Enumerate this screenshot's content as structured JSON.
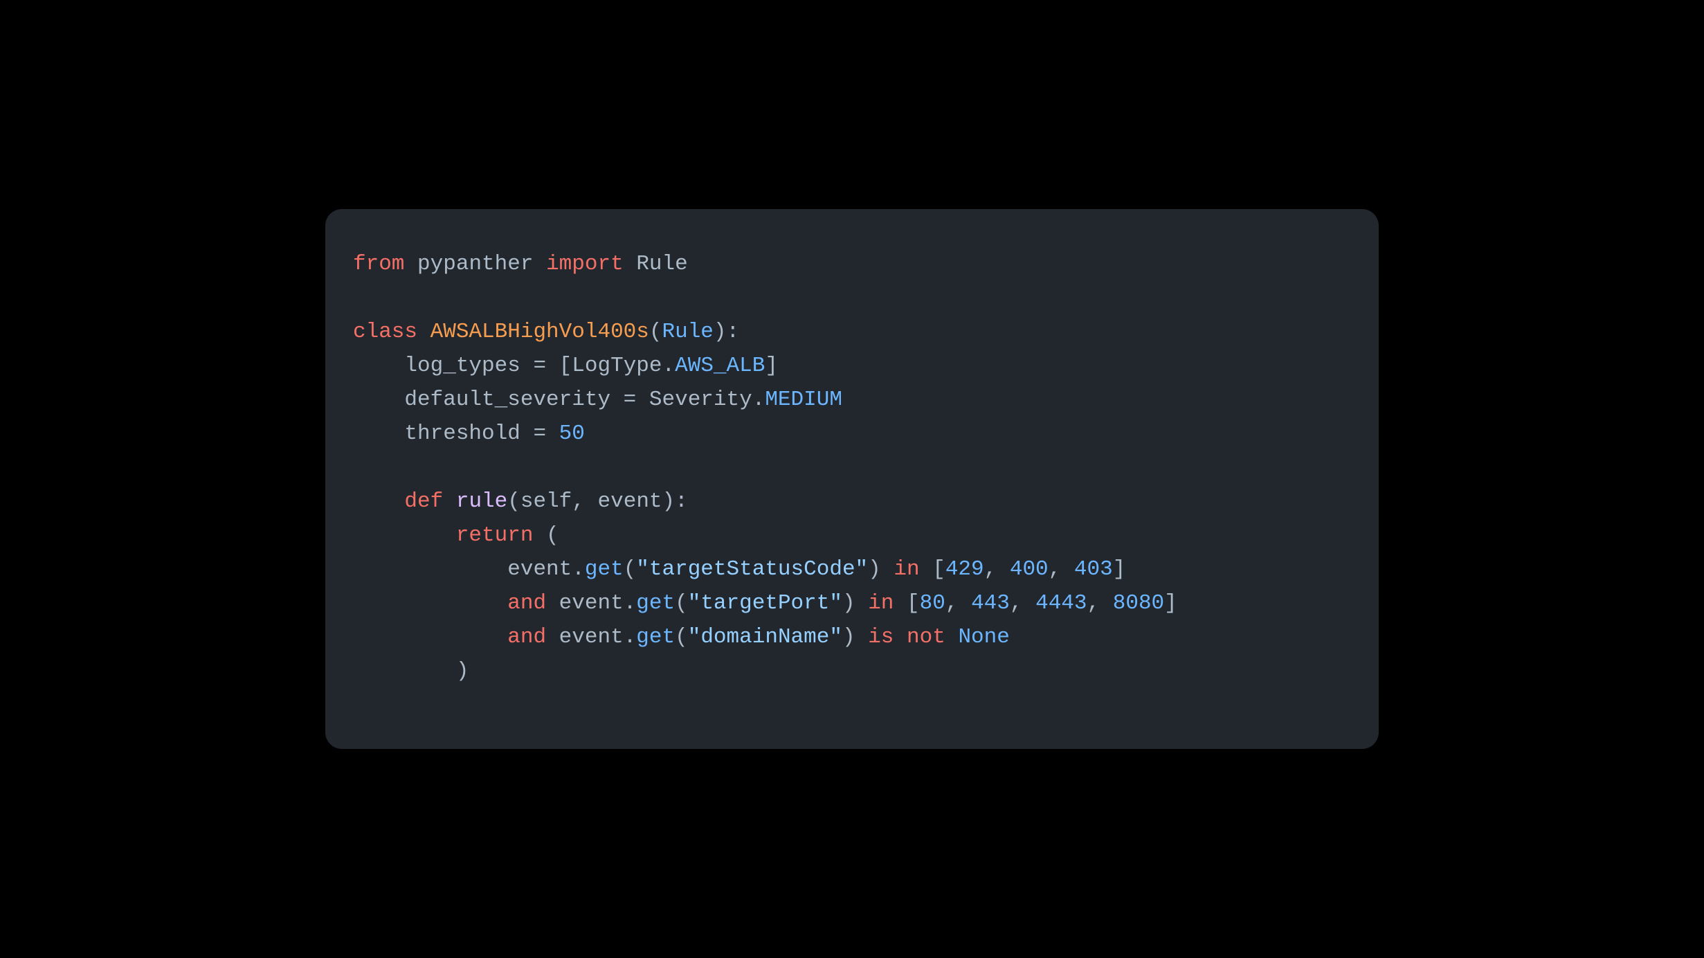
{
  "code": {
    "line1": {
      "from": "from",
      "module": "pypanther",
      "import": "import",
      "name": "Rule"
    },
    "line3": {
      "class_kw": "class",
      "class_name": "AWSALBHighVol400s",
      "lparen": "(",
      "base": "Rule",
      "rparen_colon": "):"
    },
    "line4": {
      "indent": "    ",
      "var": "log_types",
      "eq": " = [",
      "obj": "LogType",
      "dot": ".",
      "const": "AWS_ALB",
      "close": "]"
    },
    "line5": {
      "indent": "    ",
      "var": "default_severity",
      "eq": " = ",
      "obj": "Severity",
      "dot": ".",
      "const": "MEDIUM"
    },
    "line6": {
      "indent": "    ",
      "var": "threshold",
      "eq": " = ",
      "num": "50"
    },
    "line8": {
      "indent": "    ",
      "def": "def",
      "space": " ",
      "name": "rule",
      "lparen": "(",
      "self": "self",
      "comma": ", ",
      "event": "event",
      "rparen_colon": "):"
    },
    "line9": {
      "indent": "        ",
      "return": "return",
      "open": " ("
    },
    "line10": {
      "indent": "            ",
      "obj": "event",
      "dot": ".",
      "call": "get",
      "lparen": "(",
      "str": "\"targetStatusCode\"",
      "rparen": ") ",
      "in": "in",
      "open_list": " [",
      "n1": "429",
      "c1": ", ",
      "n2": "400",
      "c2": ", ",
      "n3": "403",
      "close_list": "]"
    },
    "line11": {
      "indent": "            ",
      "and": "and",
      "sp": " ",
      "obj": "event",
      "dot": ".",
      "call": "get",
      "lparen": "(",
      "str": "\"targetPort\"",
      "rparen": ") ",
      "in": "in",
      "open_list": " [",
      "n1": "80",
      "c1": ", ",
      "n2": "443",
      "c2": ", ",
      "n3": "4443",
      "c3": ", ",
      "n4": "8080",
      "close_list": "]"
    },
    "line12": {
      "indent": "            ",
      "and": "and",
      "sp": " ",
      "obj": "event",
      "dot": ".",
      "call": "get",
      "lparen": "(",
      "str": "\"domainName\"",
      "rparen": ") ",
      "is": "is",
      "sp2": " ",
      "not": "not",
      "sp3": " ",
      "none": "None"
    },
    "line13": {
      "indent": "        ",
      "close": ")"
    }
  }
}
